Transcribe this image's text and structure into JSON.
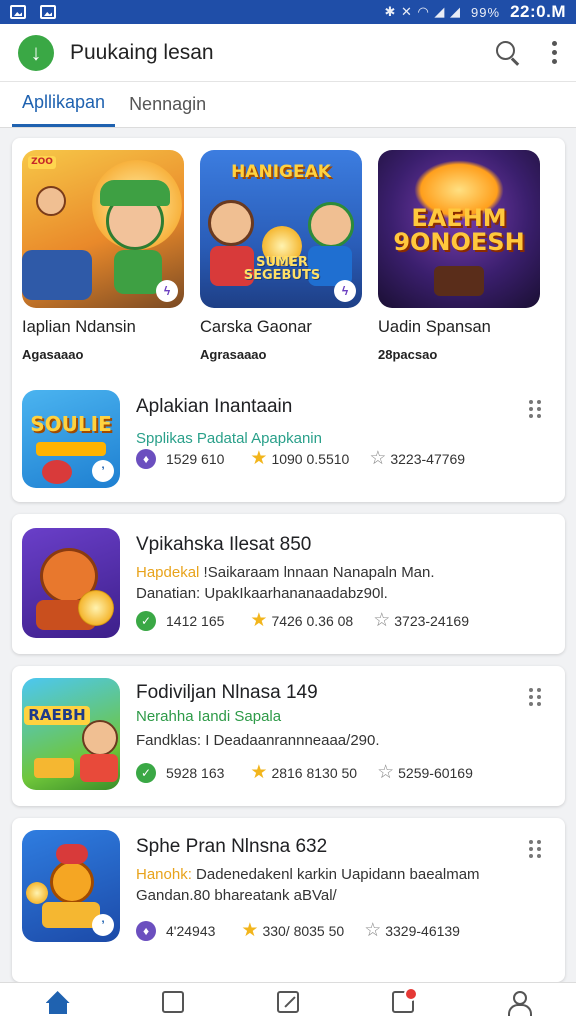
{
  "status_bar": {
    "time": "22:0.M",
    "battery": "99%"
  },
  "app_bar": {
    "title": "Puukaing lesan",
    "logo_icon": "download-arrow-icon"
  },
  "tabs": [
    {
      "label": "Apllikapan",
      "active": true
    },
    {
      "label": "Nennagin",
      "active": false
    }
  ],
  "featured": [
    {
      "name": "Iaplian Ndansin",
      "sub": "Agasaaao",
      "art_text": "",
      "colors": [
        "#f3b233",
        "#3a9e4b"
      ]
    },
    {
      "name": "Carska Gaonar",
      "sub": "Agrasaaao",
      "art_text": "SUMER SEGEBUTS",
      "colors": [
        "#2f6fd1",
        "#f5a623"
      ]
    },
    {
      "name": "Uadin Spansan",
      "sub": "28pacsao",
      "art_text": "EAEHM 9ONOESH",
      "colors": [
        "#3b1f6e",
        "#ffb321"
      ]
    }
  ],
  "items": [
    {
      "title": "Aplakian Inantaain",
      "sub": "Spplikas Padatal Apapkanin",
      "sub_color": "#2aa08a",
      "desc": "",
      "meta_icon_color": "#6b4fbf",
      "downloads": "1529 610",
      "rating": "1090  0.5510",
      "reviews": "3223-47769",
      "art_text": "SOULIE"
    },
    {
      "title": "Vpikahska Ilesat 850",
      "sub": "",
      "sub_color": "#e8a31c",
      "desc": "Hapdekal !Saikaraam lnnaan Nanapaln Man.",
      "desc2": "Danatian: UpakIkaarhananaadabz90l.",
      "desc_label": "Hapdekal",
      "meta_icon_color": "#3aa845",
      "downloads": "1412 165",
      "rating": "7426  0.36 08",
      "reviews": "3723-24169",
      "art_text": ""
    },
    {
      "title": "Fodiviljan Nlnasa 149",
      "sub": "Nerahha Iandi Sapala",
      "sub_color": "#2d9a47",
      "desc": "",
      "desc2": "Fandklas: I Deadaanrannneaaa/290.",
      "meta_icon_color": "#3aa845",
      "downloads": "5928 163",
      "rating": "2816  8130 50",
      "reviews": "5259-60169",
      "art_text": "RAEBH"
    },
    {
      "title": "Sphe Pran Nlnsna 632",
      "sub": "",
      "sub_color": "#e8a31c",
      "desc": "Hanohk: Dadenedakenl karkin Uapidann baealmam",
      "desc2": "Gandan.80 bhareatank aBVal/",
      "desc_label": "Hanohk:",
      "meta_icon_color": "#6b4fbf",
      "downloads": "4'24943",
      "rating": "330/  8035 50",
      "reviews": "3329-46139",
      "art_text": ""
    }
  ],
  "bottom_nav": [
    "home-icon",
    "library-icon",
    "edit-icon",
    "tasks-icon",
    "profile-icon"
  ]
}
